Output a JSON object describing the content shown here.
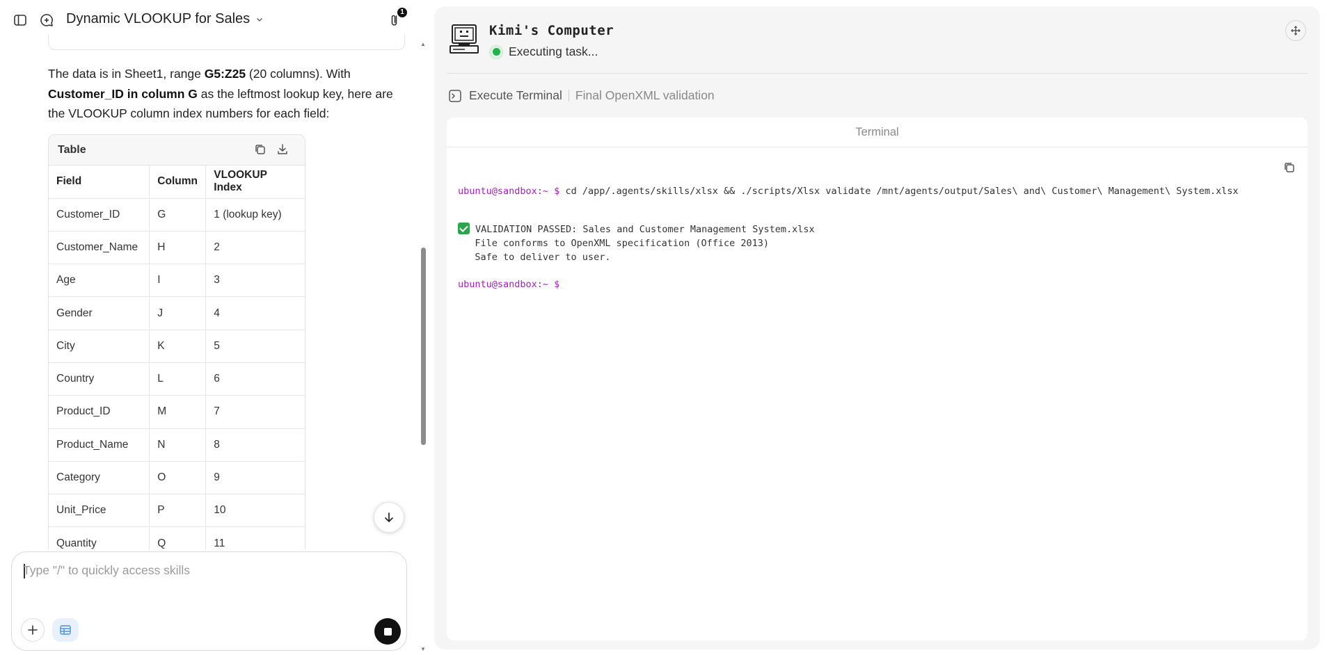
{
  "header": {
    "title": "Dynamic VLOOKUP for Sales",
    "attachment_count": "1"
  },
  "message": {
    "p_prefix": "The data is in Sheet1, range ",
    "p_range": "G5:Z25",
    "p_mid": " (20 columns). With ",
    "p_key": "Customer_ID in column G",
    "p_suffix": " as the leftmost lookup key, here are the VLOOKUP column index numbers for each field:"
  },
  "table": {
    "label": "Table",
    "headers": [
      "Field",
      "Column",
      "VLOOKUP Index"
    ],
    "rows": [
      [
        "Customer_ID",
        "G",
        "1 (lookup key)"
      ],
      [
        "Customer_Name",
        "H",
        "2"
      ],
      [
        "Age",
        "I",
        "3"
      ],
      [
        "Gender",
        "J",
        "4"
      ],
      [
        "City",
        "K",
        "5"
      ],
      [
        "Country",
        "L",
        "6"
      ],
      [
        "Product_ID",
        "M",
        "7"
      ],
      [
        "Product_Name",
        "N",
        "8"
      ],
      [
        "Category",
        "O",
        "9"
      ],
      [
        "Unit_Price",
        "P",
        "10"
      ],
      [
        "Quantity",
        "Q",
        "11"
      ]
    ]
  },
  "composer": {
    "placeholder": "Type \"/\" to quickly access skills"
  },
  "computer": {
    "title": "Kimi's Computer",
    "status": "Executing task...",
    "status_color": "#22b14c",
    "tool_name": "Execute Terminal",
    "tool_desc": "Final OpenXML validation"
  },
  "terminal": {
    "label": "Terminal",
    "prompt": "ubuntu@sandbox:~ $",
    "command": " cd /app/.agents/skills/xlsx && ./scripts/Xlsx validate /mnt/agents/output/Sales\\ and\\ Customer\\ Management\\ System.xlsx",
    "result_line": "VALIDATION PASSED: Sales and Customer Management System.xlsx",
    "detail_1": "   File conforms to OpenXML specification (Office 2013)",
    "detail_2": "   Safe to deliver to user.",
    "prompt_2": "ubuntu@sandbox:~ $"
  }
}
